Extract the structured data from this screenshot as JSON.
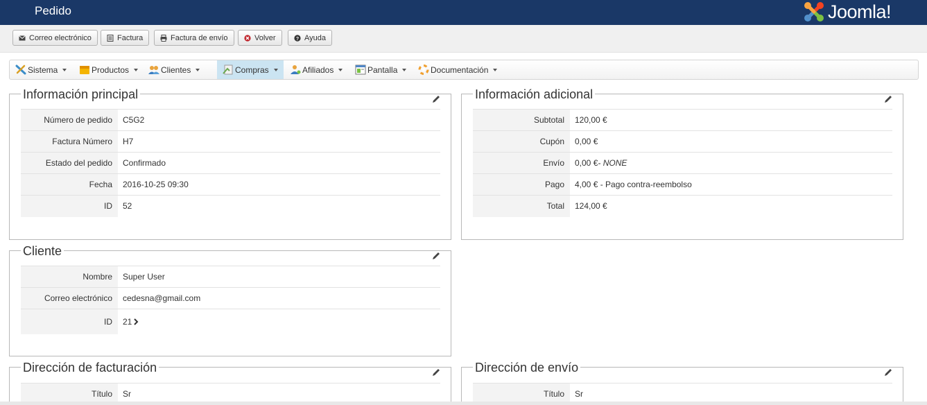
{
  "header": {
    "title": "Pedido",
    "brand": "Joomla!"
  },
  "toolbar": [
    {
      "label": "Correo electrónico",
      "icon": "envelope-icon"
    },
    {
      "label": "Factura",
      "icon": "invoice-icon"
    },
    {
      "label": "Factura de envío",
      "icon": "printer-icon"
    },
    {
      "label": "Volver",
      "icon": "cancel-icon"
    },
    {
      "label": "Ayuda",
      "icon": "help-icon"
    }
  ],
  "menu": [
    {
      "label": "Sistema",
      "icon": "tools-icon"
    },
    {
      "label": "Productos",
      "icon": "box-icon"
    },
    {
      "label": "Clientes",
      "icon": "users-icon"
    },
    {
      "label": "Compras",
      "icon": "purchases-icon",
      "active": true
    },
    {
      "label": "Afiliados",
      "icon": "affiliates-icon"
    },
    {
      "label": "Pantalla",
      "icon": "display-icon"
    },
    {
      "label": "Documentación",
      "icon": "help-ring-icon"
    }
  ],
  "main_info": {
    "legend": "Información principal",
    "rows": [
      {
        "key": "Número de pedido",
        "value": "C5G2"
      },
      {
        "key": "Factura Número",
        "value": "H7"
      },
      {
        "key": "Estado del pedido",
        "value": "Confirmado"
      },
      {
        "key": "Fecha",
        "value": "2016-10-25 09:30"
      },
      {
        "key": "ID",
        "value": "52"
      }
    ]
  },
  "additional_info": {
    "legend": "Información adicional",
    "rows": [
      {
        "key": "Subtotal",
        "value": "120,00 €"
      },
      {
        "key": "Cupón",
        "value": "0,00 €"
      },
      {
        "key": "Envío",
        "value": "0,00 €",
        "note": "- NONE"
      },
      {
        "key": "Pago",
        "value": "4,00 € - Pago contra-reembolso"
      },
      {
        "key": "Total",
        "value": "124,00 €"
      }
    ]
  },
  "customer": {
    "legend": "Cliente",
    "rows": [
      {
        "key": "Nombre",
        "value": "Super User"
      },
      {
        "key": "Correo electrónico",
        "value": "cedesna@gmail.com"
      },
      {
        "key": "ID",
        "value": "21"
      }
    ]
  },
  "billing": {
    "legend": "Dirección de facturación",
    "rows": [
      {
        "key": "Título",
        "value": "Sr"
      }
    ]
  },
  "shipping": {
    "legend": "Dirección de envío",
    "rows": [
      {
        "key": "Título",
        "value": "Sr"
      }
    ]
  },
  "colors": {
    "topbar": "#1a3867",
    "active_menu": "#cbe4f2"
  }
}
